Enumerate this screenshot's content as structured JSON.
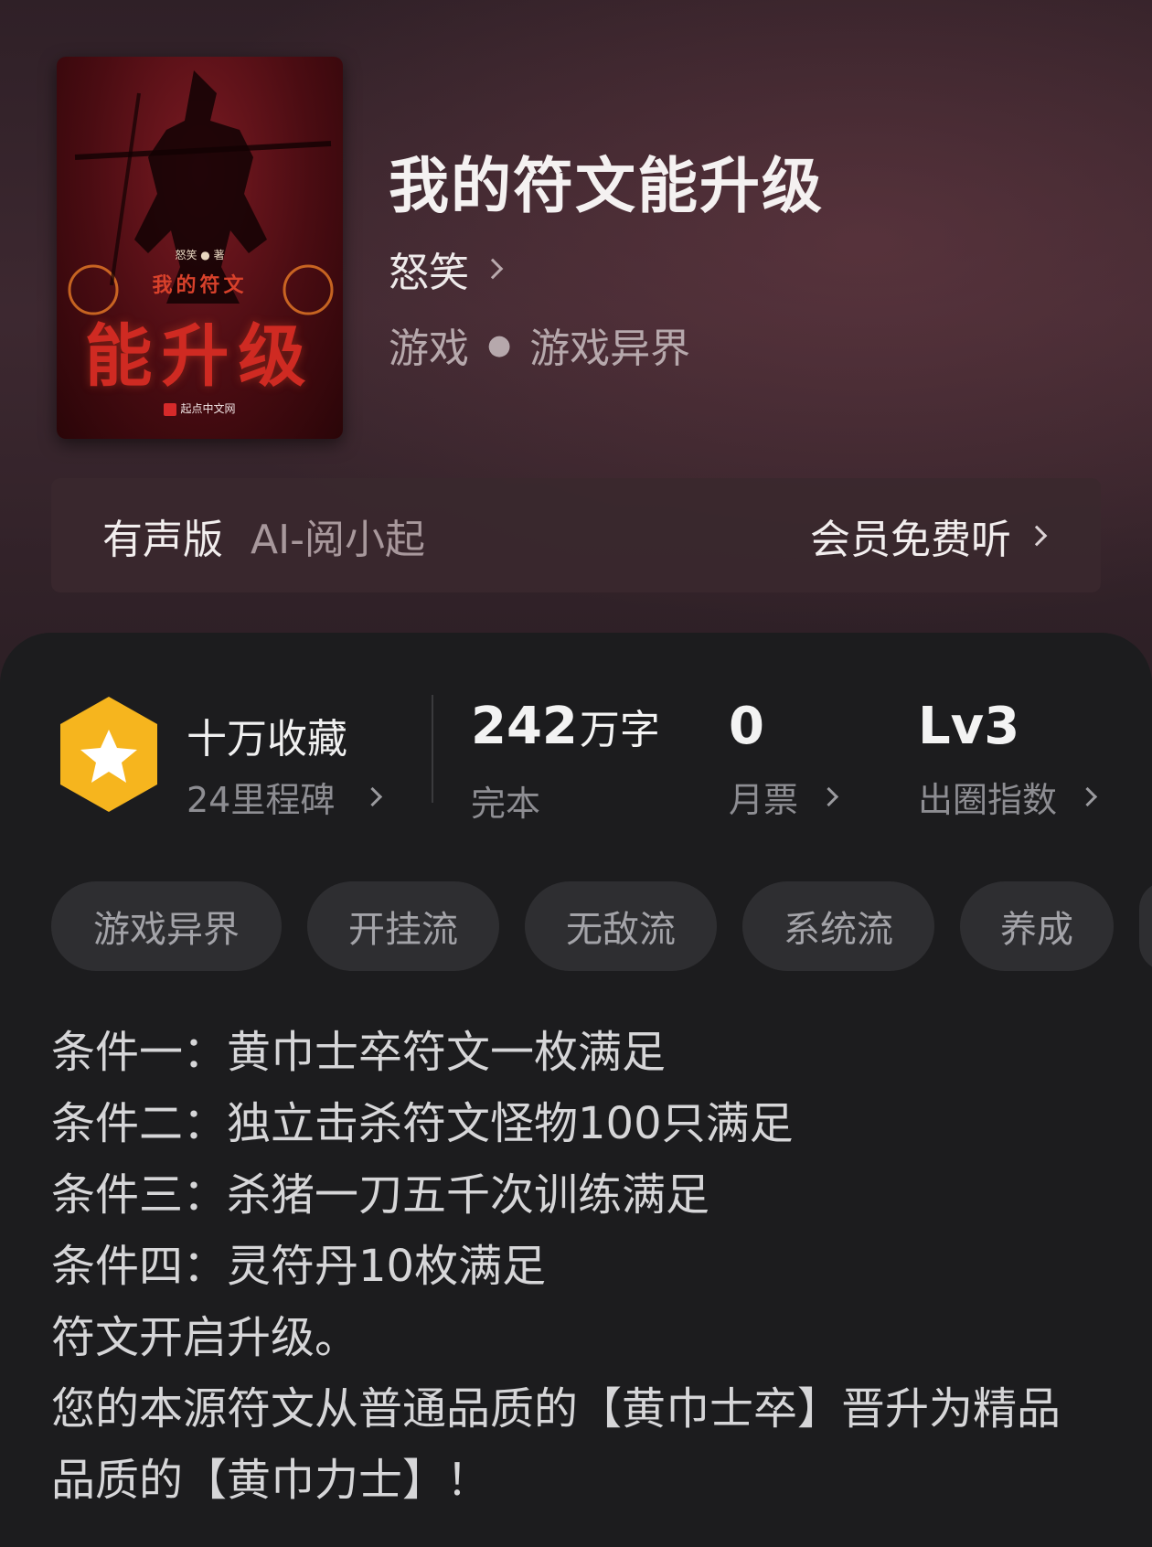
{
  "book": {
    "title": "我的符文能升级",
    "author": "怒笑",
    "category": "游戏",
    "subcategory": "游戏异界",
    "cover": {
      "author_text": "怒笑 ● 著",
      "sub_title": "我的符文",
      "main_title": "能升级",
      "publisher": "起点中文网"
    }
  },
  "audio": {
    "label": "有声版",
    "voice": "AI-阅小起",
    "cta": "会员免费听"
  },
  "stats": {
    "collect_title": "十万收藏",
    "collect_sub": "24里程碑",
    "words_value": "242",
    "words_unit": "万字",
    "words_sub": "完本",
    "tickets_value": "0",
    "tickets_sub": "月票",
    "index_value": "Lv3",
    "index_sub": "出圈指数"
  },
  "tags": [
    "游戏异界",
    "开挂流",
    "无敌流",
    "系统流",
    "养成"
  ],
  "description": [
    "条件一：黄巾士卒符文一枚满足",
    "条件二：独立击杀符文怪物100只满足",
    "条件三：杀猪一刀五千次训练满足",
    "条件四：灵符丹10枚满足",
    "符文开启升级。",
    "您的本源符文从普通品质的【黄巾士卒】晋升为精品品质的【黄巾力士】！"
  ],
  "colors": {
    "hero_bg": "#3d2830",
    "panel_bg": "#1c1c1e",
    "badge": "#f6b51e",
    "tag_bg": "#2e2e31"
  },
  "icons": {
    "badge": "star-hexagon-icon",
    "chevron": "chevron-right-icon"
  }
}
